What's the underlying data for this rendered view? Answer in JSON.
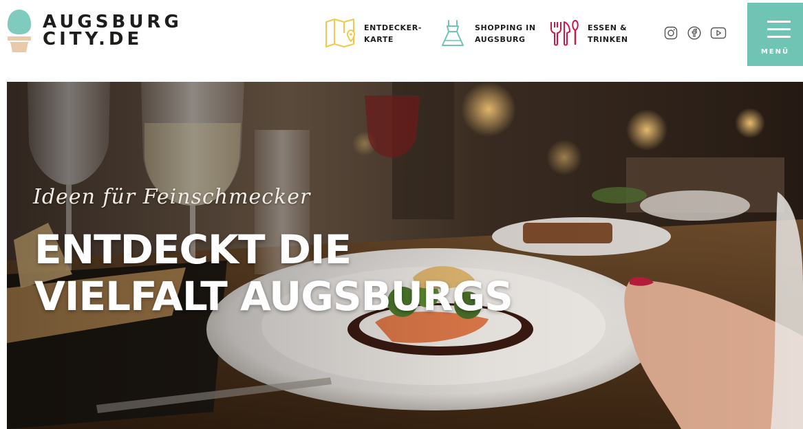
{
  "header": {
    "logo": {
      "line1": "AUGSBURG",
      "line2": "CITY.DE"
    },
    "nav": [
      {
        "line1": "ENTDECKER-",
        "line2": "KARTE",
        "icon": "map-pin-icon",
        "color": "#f2c94c"
      },
      {
        "line1": "SHOPPING IN",
        "line2": "AUGSBURG",
        "icon": "dress-icon",
        "color": "#6fc4b4"
      },
      {
        "line1": "ESSEN &",
        "line2": "TRINKEN",
        "icon": "cutlery-icon",
        "color": "#c8194b"
      }
    ],
    "social": [
      "instagram-icon",
      "facebook-icon",
      "youtube-icon"
    ],
    "menu": {
      "label": "MENÜ",
      "color": "#6fc4b4"
    }
  },
  "hero": {
    "tagline": "Ideen für Feinschmecker",
    "title_line1": "ENTDECKT DIE",
    "title_line2": "VIELFALT AUGSBURGS"
  }
}
